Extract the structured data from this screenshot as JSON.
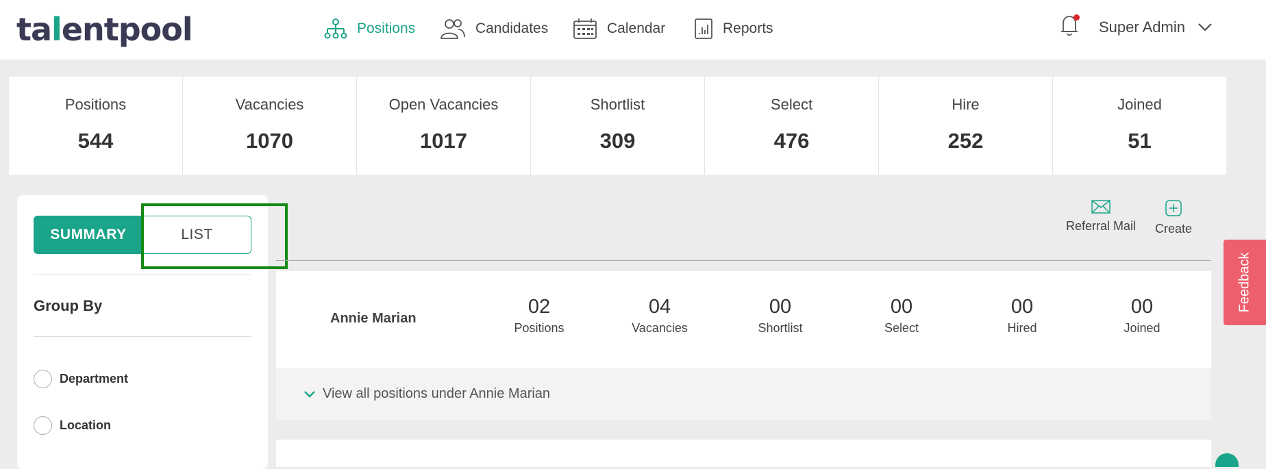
{
  "brand": {
    "logo_prefix": "ta",
    "logo_accent": "l",
    "logo_suffix": "entpool"
  },
  "nav": [
    {
      "label": "Positions",
      "icon": "org-chart-icon",
      "active": true
    },
    {
      "label": "Candidates",
      "icon": "people-icon",
      "active": false
    },
    {
      "label": "Calendar",
      "icon": "calendar-icon",
      "active": false
    },
    {
      "label": "Reports",
      "icon": "report-icon",
      "active": false
    }
  ],
  "user": {
    "name": "Super Admin",
    "notifications_dot": true
  },
  "stats": [
    {
      "label": "Positions",
      "value": "544"
    },
    {
      "label": "Vacancies",
      "value": "1070"
    },
    {
      "label": "Open Vacancies",
      "value": "1017"
    },
    {
      "label": "Shortlist",
      "value": "309"
    },
    {
      "label": "Select",
      "value": "476"
    },
    {
      "label": "Hire",
      "value": "252"
    },
    {
      "label": "Joined",
      "value": "51"
    }
  ],
  "view_toggle": {
    "summary_label": "SUMMARY",
    "list_label": "LIST",
    "selected": "SUMMARY"
  },
  "group_by": {
    "title": "Group By",
    "options": [
      {
        "label": "Department"
      },
      {
        "label": "Location"
      }
    ]
  },
  "actions": {
    "referral_mail": "Referral Mail",
    "create": "Create"
  },
  "summary_card": {
    "name": "Annie Marian",
    "metrics": [
      {
        "value": "02",
        "label": "Positions"
      },
      {
        "value": "04",
        "label": "Vacancies"
      },
      {
        "value": "00",
        "label": "Shortlist"
      },
      {
        "value": "00",
        "label": "Select"
      },
      {
        "value": "00",
        "label": "Hired"
      },
      {
        "value": "00",
        "label": "Joined"
      }
    ],
    "view_all": "View all positions under Annie Marian"
  },
  "feedback": {
    "label": "Feedback"
  },
  "colors": {
    "accent": "#1aa489",
    "highlight": "#168a16",
    "feedback": "#ee5f6e",
    "alert_dot": "#e0252a"
  }
}
